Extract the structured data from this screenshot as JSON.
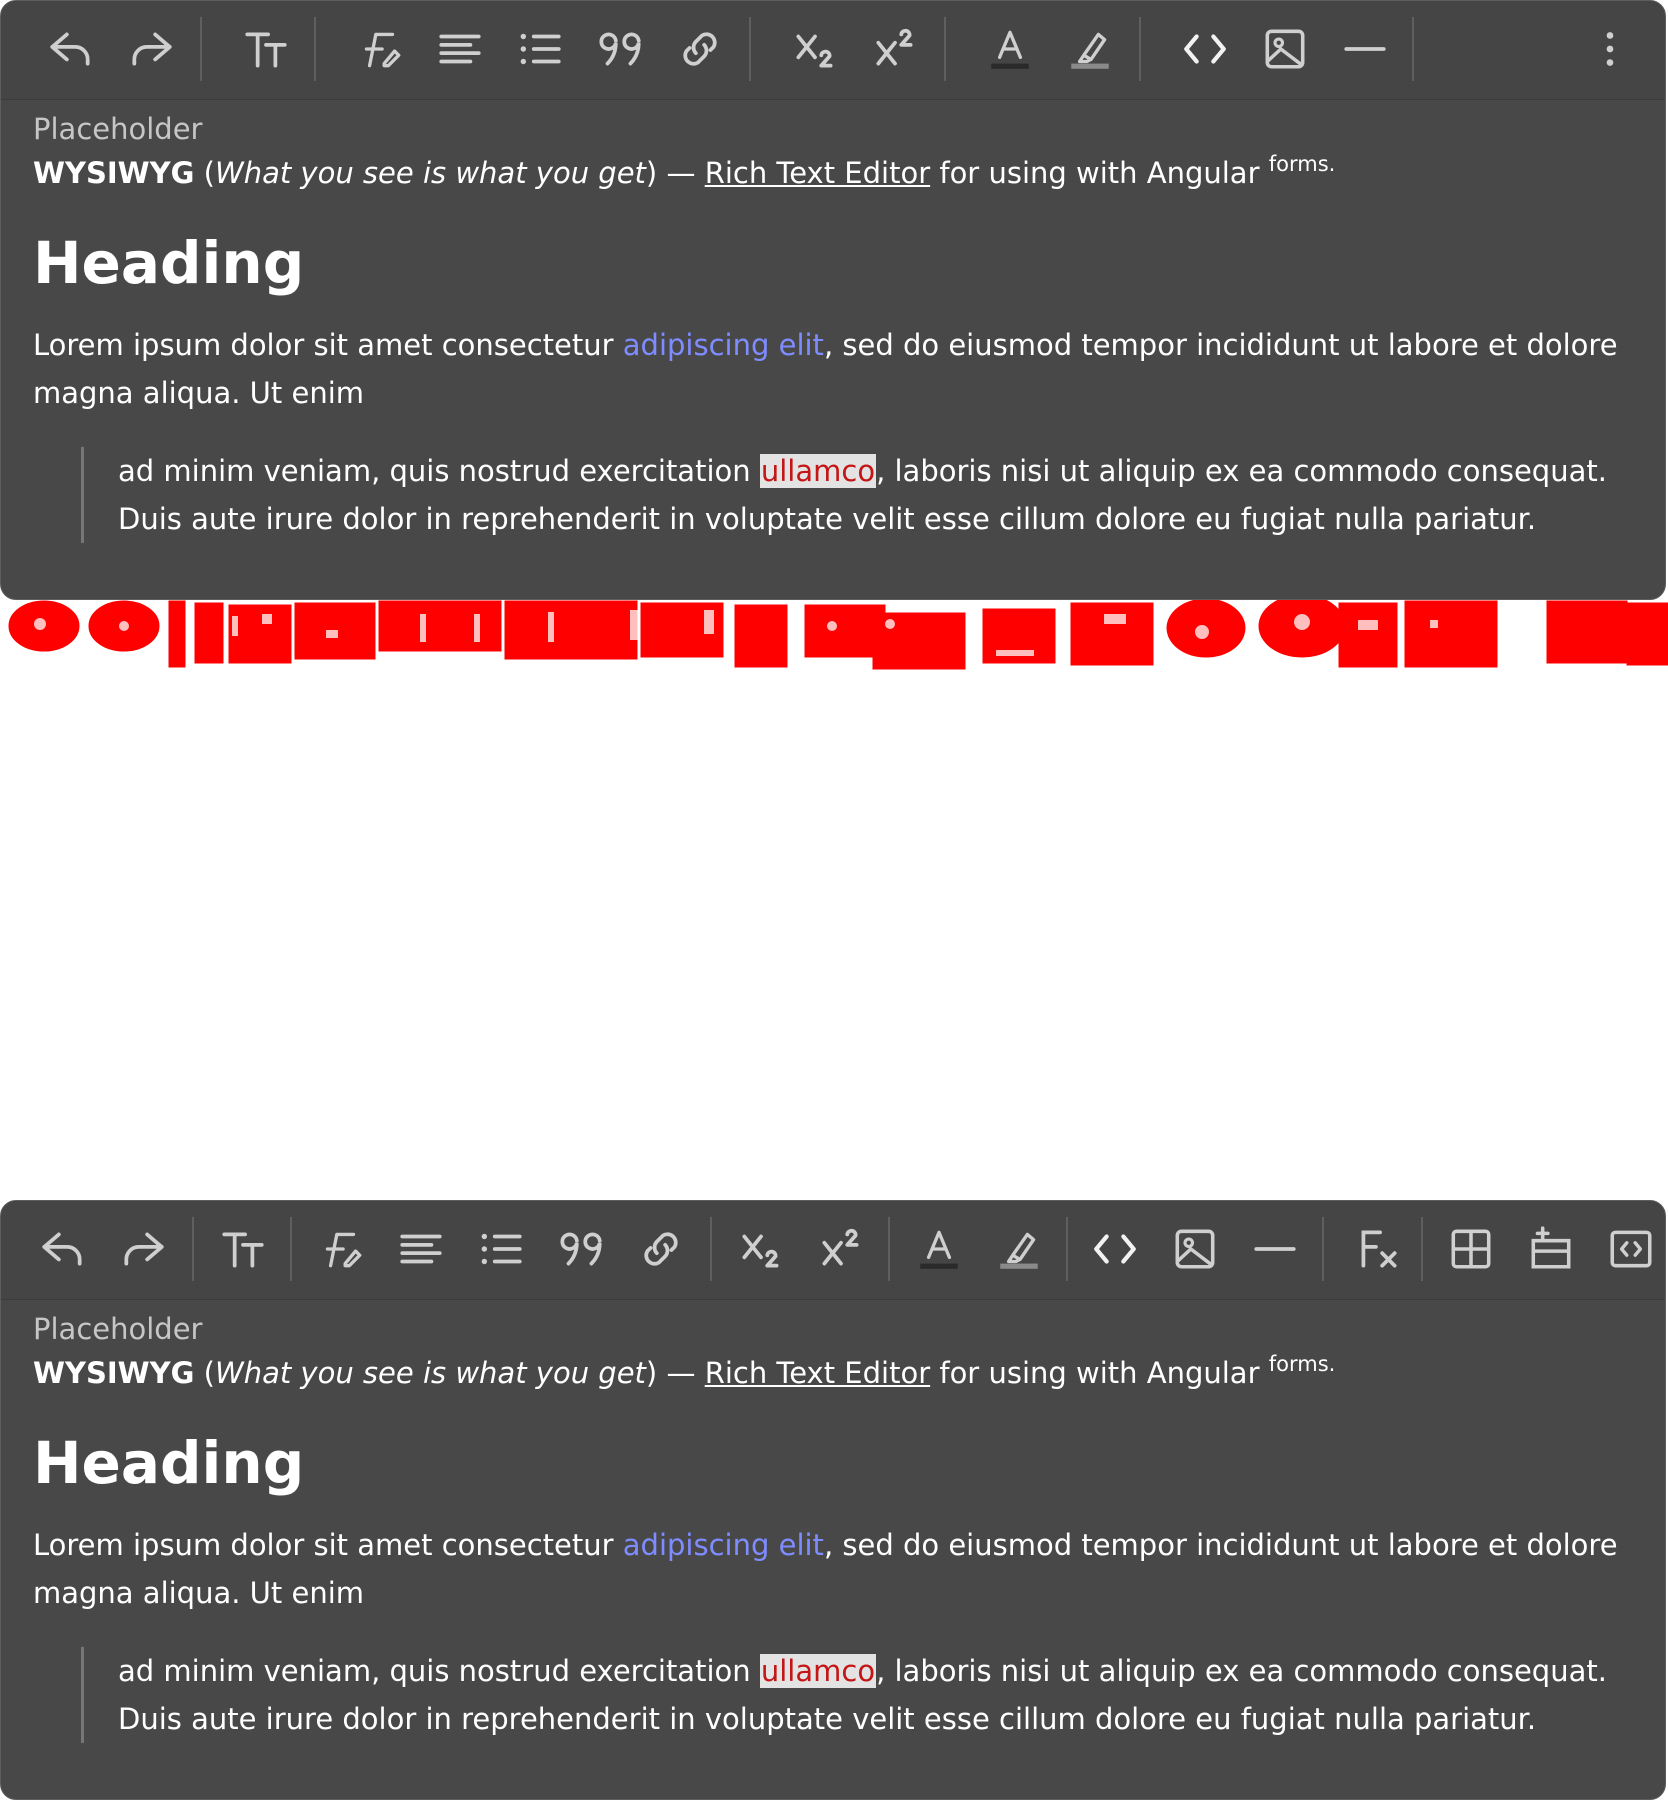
{
  "editor_text": {
    "placeholder": "Placeholder",
    "intro_bold": "WYSIWYG",
    "intro_paren_open": " (",
    "intro_italic": "What you see is what you get",
    "intro_paren_close": ") — ",
    "intro_link": "Rich Text Editor",
    "intro_rest": " for using with Angular ",
    "intro_sup": "forms.",
    "heading": "Heading",
    "para_before": "Lorem ipsum dolor sit amet consectetur ",
    "para_link": "adipiscing elit",
    "para_after": ", sed do eiusmod tempor incididunt ut labore et dolore magna aliqua. Ut enim",
    "quote_before": "ad minim veniam, quis nostrud exercitation ",
    "quote_mark": "ullamco",
    "quote_after": ", laboris nisi ut aliquip ex ea commodo consequat. Duis aute irure dolor in reprehenderit in voluptate velit esse cillum dolore eu fugiat nulla pariatur."
  },
  "toolbar_top": {
    "buttons": [
      "undo",
      "redo",
      "text-size",
      "text-style",
      "align",
      "list",
      "quote",
      "link",
      "subscript",
      "superscript",
      "font-color",
      "highlight",
      "code",
      "image",
      "horizontal-rule",
      "more"
    ]
  },
  "toolbar_bottom": {
    "buttons": [
      "undo",
      "redo",
      "text-size",
      "text-style",
      "align",
      "list",
      "quote",
      "link",
      "subscript",
      "superscript",
      "font-color",
      "highlight",
      "code",
      "image",
      "horizontal-rule",
      "clear-format",
      "table",
      "insert-row",
      "html-source"
    ]
  },
  "colors": {
    "editor_bg": "#484848",
    "toolbar_bg": "#454545",
    "icon": "#cfcfcf",
    "link": "#7f8cff",
    "mark_bg": "#e3e3e3",
    "mark_text": "#c41616",
    "overlay": "#ff0000"
  }
}
